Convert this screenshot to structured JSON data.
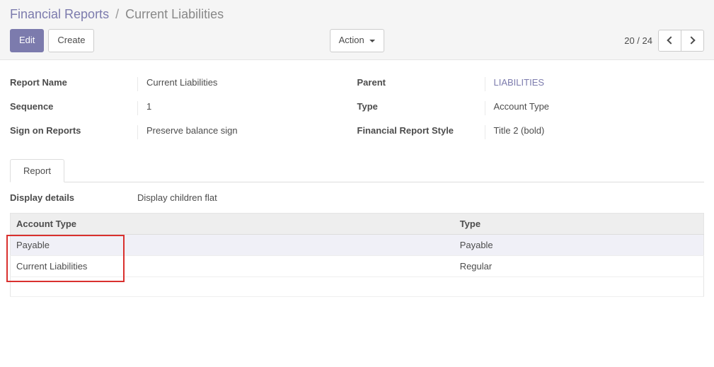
{
  "breadcrumb": {
    "parent": "Financial Reports",
    "sep": "/",
    "current": "Current Liabilities"
  },
  "toolbar": {
    "edit": "Edit",
    "create": "Create",
    "action": "Action"
  },
  "pager": {
    "value": "20 / 24"
  },
  "form": {
    "left": {
      "report_name_label": "Report Name",
      "report_name_value": "Current Liabilities",
      "sequence_label": "Sequence",
      "sequence_value": "1",
      "sign_label": "Sign on Reports",
      "sign_value": "Preserve balance sign"
    },
    "right": {
      "parent_label": "Parent",
      "parent_value": "LIABILITIES",
      "type_label": "Type",
      "type_value": "Account Type",
      "style_label": "Financial Report Style",
      "style_value": "Title 2 (bold)"
    }
  },
  "tabs": {
    "report": "Report"
  },
  "tab_content": {
    "display_details_label": "Display details",
    "display_details_value": "Display children flat",
    "columns": {
      "0": "Account Type",
      "1": "Type"
    },
    "rows": {
      "0": {
        "account_type": "Payable",
        "type": "Payable"
      },
      "1": {
        "account_type": "Current Liabilities",
        "type": "Regular"
      }
    }
  }
}
